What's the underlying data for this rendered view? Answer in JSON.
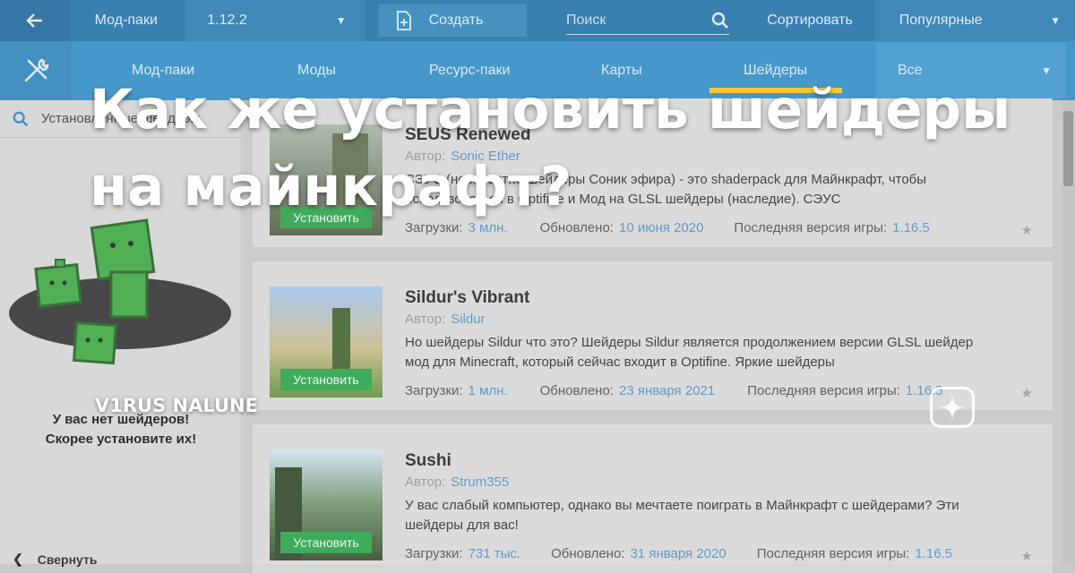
{
  "topbar": {
    "modpacks_label": "Мод-паки",
    "version": "1.12.2",
    "create_label": "Создать",
    "search_placeholder": "Поиск",
    "sort_label": "Сортировать",
    "sort_value": "Популярные"
  },
  "nav": {
    "tabs": [
      "Мод-паки",
      "Моды",
      "Ресурс-паки",
      "Карты",
      "Шейдеры"
    ],
    "active_tab": "Шейдеры",
    "filter_value": "Все"
  },
  "sidebar": {
    "search_text": "Установленные шейдеры",
    "empty_line1": "У вас нет шейдеров!",
    "empty_line2": "Скорее установите их!",
    "collapse_label": "Свернуть"
  },
  "cards": [
    {
      "title": "SEUS Renewed",
      "author_label": "Автор:",
      "author": "Sonic Ether",
      "desc": "СЭУС (невероятно шейдеры Соник эфира) - это shaderpack для Майнкрафт, чтобы использоваться в Optifine и Мод на GLSL шейдеры (наследие). СЭУС",
      "downloads_label": "Загрузки:",
      "downloads": "3 млн.",
      "updated_label": "Обновлено:",
      "updated": "10 июня 2020",
      "version_label": "Последняя версия игры:",
      "version": "1.16.5",
      "install_label": "Установить"
    },
    {
      "title": "Sildur's Vibrant",
      "author_label": "Автор:",
      "author": "Sildur",
      "desc": "Но шейдеры Sildur что это? Шейдеры Sildur является продолжением версии GLSL шейдер мод для Minecraft, который сейчас входит в Optifine. Яркие шейдеры",
      "downloads_label": "Загрузки:",
      "downloads": "1 млн.",
      "updated_label": "Обновлено:",
      "updated": "23 января 2021",
      "version_label": "Последняя версия игры:",
      "version": "1.16.5",
      "install_label": "Установить"
    },
    {
      "title": "Sushi",
      "author_label": "Автор:",
      "author": "Strum355",
      "desc": "У вас слабый компьютер, однако вы мечтаете поиграть в Майнкрафт с шейдерами? Эти шейдеры для вас!",
      "downloads_label": "Загрузки:",
      "downloads": "731 тыс.",
      "updated_label": "Обновлено:",
      "updated": "31 января 2020",
      "version_label": "Последняя версия игры:",
      "version": "1.16.5",
      "install_label": "Установить"
    }
  ],
  "overlay": {
    "headline": "Как же установить шейдеры на майнкрафт?",
    "author": "V1RUS NALUNE"
  },
  "colors": {
    "topbar": "#1d6fa5",
    "navbar": "#2d8ac4",
    "active_tab_underline": "#f5c218",
    "install_button": "#27a046",
    "link": "#4a8dc0"
  }
}
